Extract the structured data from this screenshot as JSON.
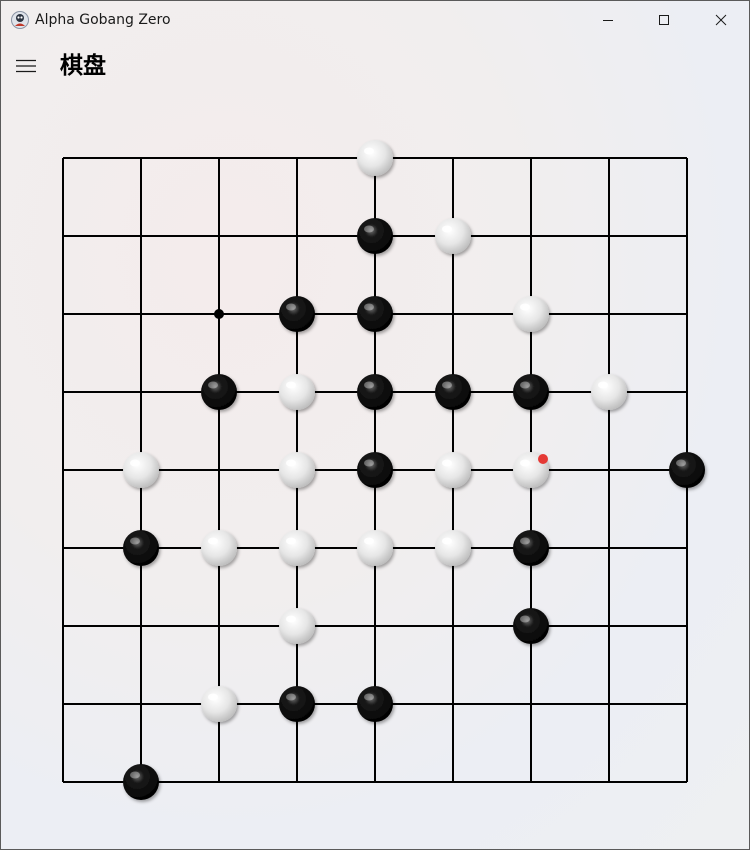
{
  "window": {
    "title": "Alpha Gobang Zero",
    "controls": {
      "minimize": "minimize",
      "maximize": "maximize",
      "close": "close"
    }
  },
  "header": {
    "menu_icon": "hamburger-menu-icon",
    "title": "棋盘"
  },
  "board": {
    "size": 9,
    "line_color": "#000000",
    "star_points": [
      [
        2,
        2
      ],
      [
        2,
        6
      ]
    ],
    "last_move": {
      "row": 4,
      "col": 6,
      "marker_color": "#e53935"
    },
    "stones": [
      {
        "row": 0,
        "col": 4,
        "color": "white"
      },
      {
        "row": 1,
        "col": 4,
        "color": "black"
      },
      {
        "row": 1,
        "col": 5,
        "color": "white"
      },
      {
        "row": 2,
        "col": 3,
        "color": "black"
      },
      {
        "row": 2,
        "col": 4,
        "color": "black"
      },
      {
        "row": 2,
        "col": 6,
        "color": "white"
      },
      {
        "row": 3,
        "col": 2,
        "color": "black"
      },
      {
        "row": 3,
        "col": 3,
        "color": "white"
      },
      {
        "row": 3,
        "col": 4,
        "color": "black"
      },
      {
        "row": 3,
        "col": 5,
        "color": "black"
      },
      {
        "row": 3,
        "col": 6,
        "color": "black"
      },
      {
        "row": 3,
        "col": 7,
        "color": "white"
      },
      {
        "row": 4,
        "col": 1,
        "color": "white"
      },
      {
        "row": 4,
        "col": 3,
        "color": "white"
      },
      {
        "row": 4,
        "col": 4,
        "color": "black"
      },
      {
        "row": 4,
        "col": 5,
        "color": "white"
      },
      {
        "row": 4,
        "col": 6,
        "color": "white"
      },
      {
        "row": 4,
        "col": 8,
        "color": "black"
      },
      {
        "row": 5,
        "col": 1,
        "color": "black"
      },
      {
        "row": 5,
        "col": 2,
        "color": "white"
      },
      {
        "row": 5,
        "col": 3,
        "color": "white"
      },
      {
        "row": 5,
        "col": 4,
        "color": "white"
      },
      {
        "row": 5,
        "col": 5,
        "color": "white"
      },
      {
        "row": 5,
        "col": 6,
        "color": "black"
      },
      {
        "row": 6,
        "col": 3,
        "color": "white"
      },
      {
        "row": 6,
        "col": 6,
        "color": "black"
      },
      {
        "row": 7,
        "col": 2,
        "color": "white"
      },
      {
        "row": 7,
        "col": 3,
        "color": "black"
      },
      {
        "row": 7,
        "col": 4,
        "color": "black"
      },
      {
        "row": 8,
        "col": 1,
        "color": "black"
      }
    ]
  }
}
